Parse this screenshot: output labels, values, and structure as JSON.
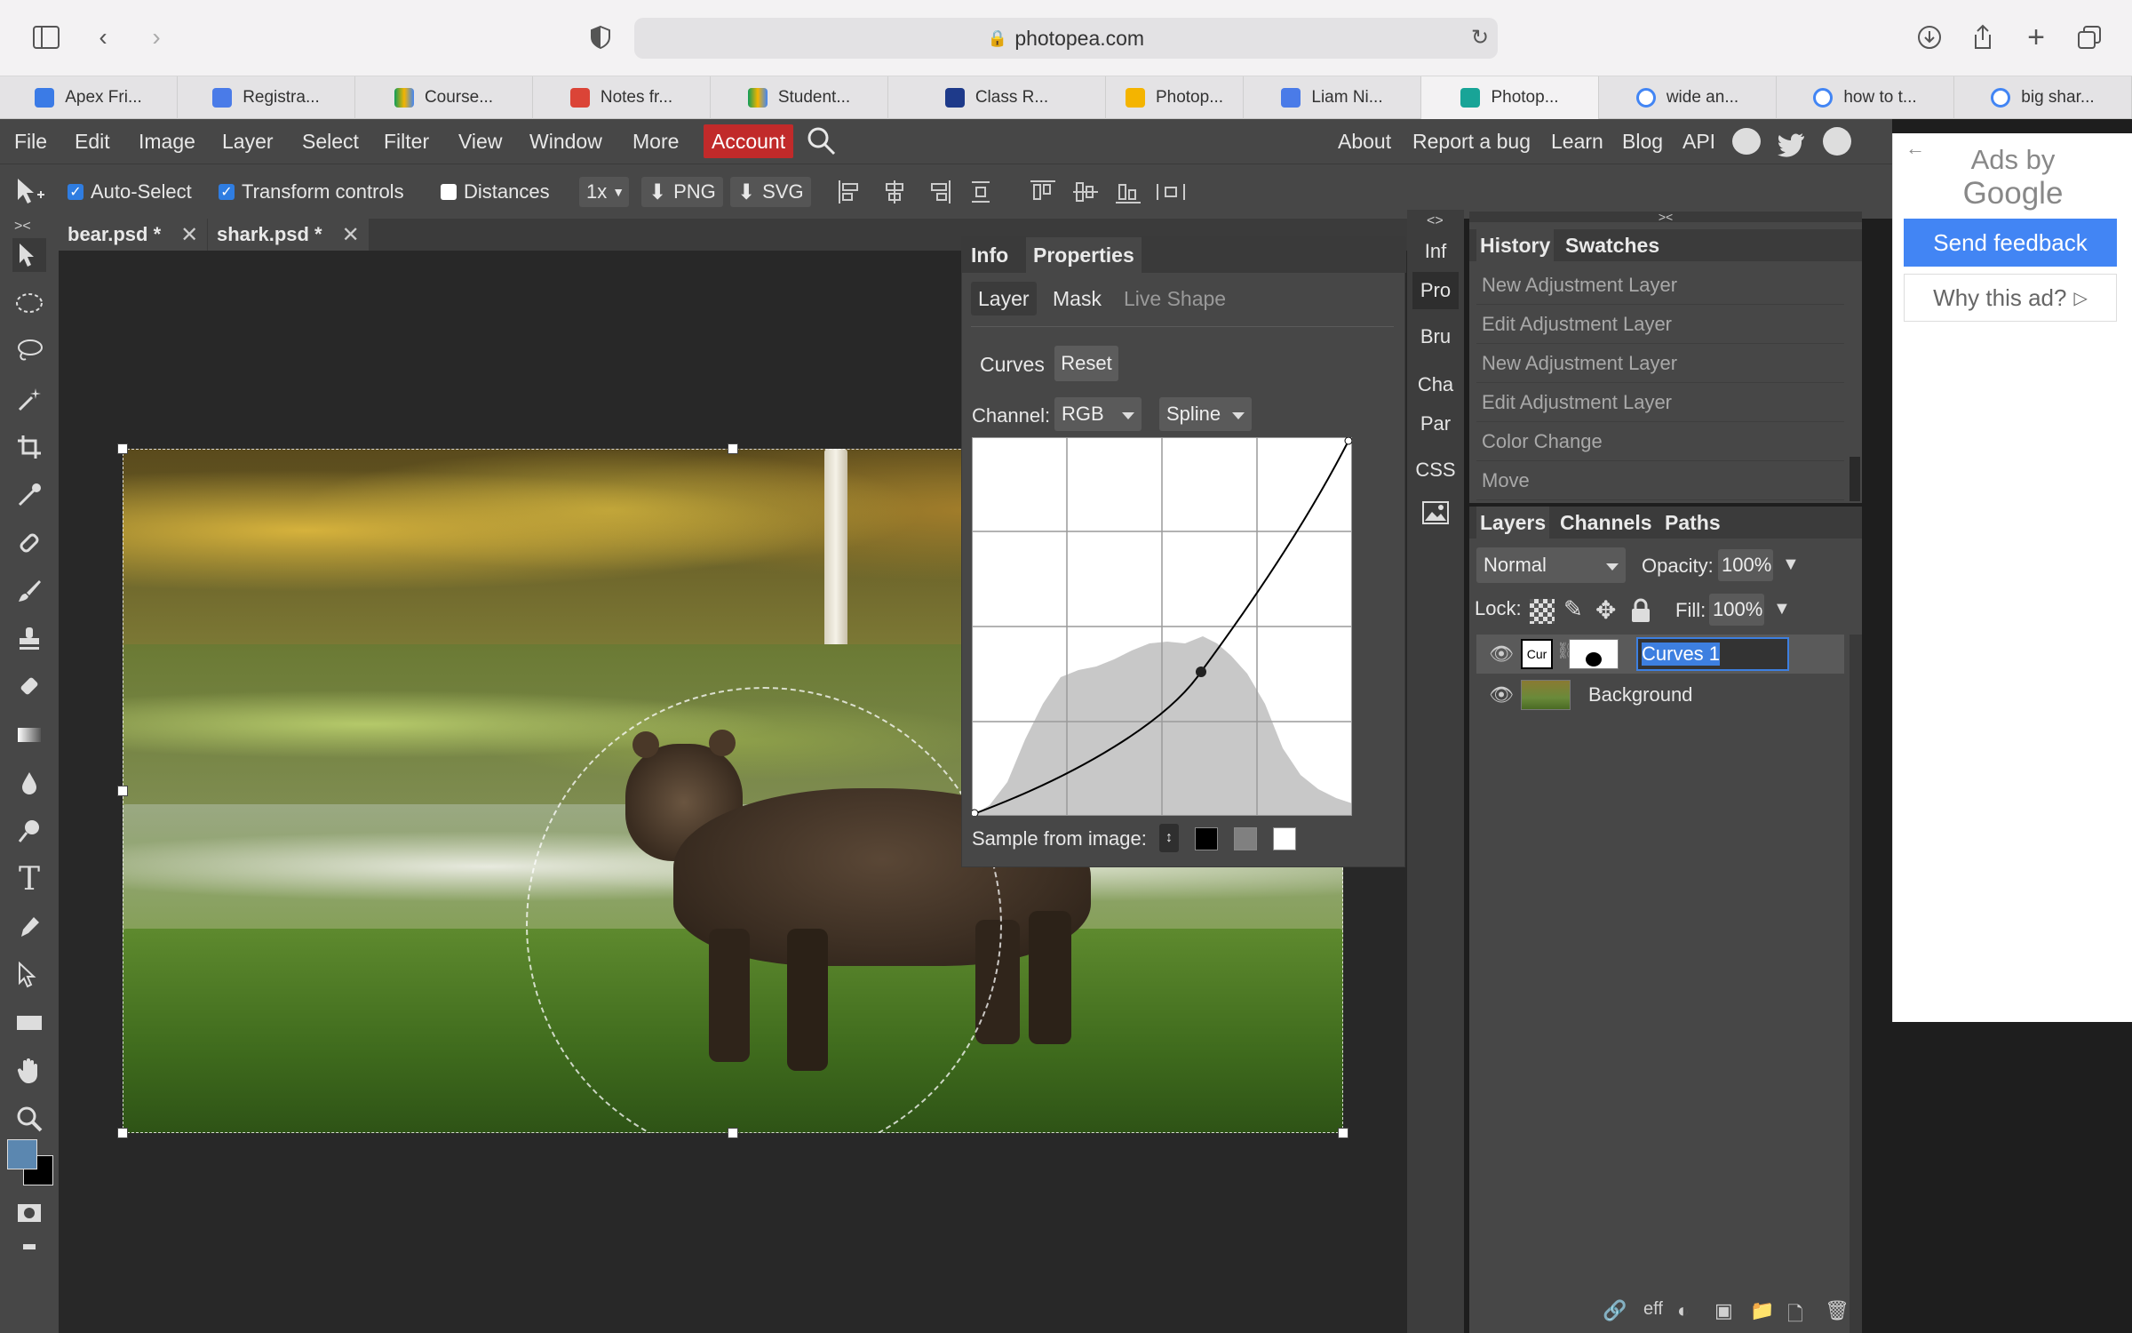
{
  "browser": {
    "url": "photopea.com",
    "tabs": [
      {
        "label": "Apex Fri...",
        "color": "#3b7be6"
      },
      {
        "label": "Registra...",
        "color": "#4a7be8"
      },
      {
        "label": "Course...",
        "color": "#f4b400"
      },
      {
        "label": "Notes fr...",
        "color": "#db4437"
      },
      {
        "label": "Student...",
        "color": "#0f9d58"
      },
      {
        "label": "Class R...",
        "color": "#1e3a8a"
      },
      {
        "label": "Photop...",
        "color": "#f4b400"
      },
      {
        "label": "Liam Ni...",
        "color": "#4a7be8"
      },
      {
        "label": "Photop...",
        "color": "#18a497"
      },
      {
        "label": "wide an...",
        "color": "#4285f4"
      },
      {
        "label": "how to t...",
        "color": "#4285f4"
      },
      {
        "label": "big shar...",
        "color": "#4285f4"
      }
    ],
    "active_tab": 8
  },
  "menu": {
    "items": [
      "File",
      "Edit",
      "Image",
      "Layer",
      "Select",
      "Filter",
      "View",
      "Window",
      "More"
    ],
    "account": "Account",
    "right_items": [
      "About",
      "Report a bug",
      "Learn",
      "Blog",
      "API"
    ]
  },
  "options": {
    "auto_select": "Auto-Select",
    "transform_controls": "Transform controls",
    "distances": "Distances",
    "zoom": "1x",
    "png": "PNG",
    "svg": "SVG"
  },
  "doc_tabs": [
    "bear.psd *",
    "shark.psd *"
  ],
  "properties": {
    "tab_info": "Info",
    "tab_properties": "Properties",
    "sub_tabs": [
      "Layer",
      "Mask",
      "Live Shape"
    ],
    "curves_label": "Curves",
    "reset_label": "Reset",
    "channel_label": "Channel:",
    "channel_value": "RGB",
    "mode_value": "Spline",
    "sample_label": "Sample from image:"
  },
  "side_buttons": [
    "Inf",
    "Pro",
    "Bru",
    "Cha",
    "Par",
    "CSS"
  ],
  "history": {
    "tab_history": "History",
    "tab_swatches": "Swatches",
    "items": [
      "New Adjustment Layer",
      "Edit Adjustment Layer",
      "New Adjustment Layer",
      "Edit Adjustment Layer",
      "Color Change",
      "Move"
    ]
  },
  "layers": {
    "tabs": [
      "Layers",
      "Channels",
      "Paths"
    ],
    "blend_mode": "Normal",
    "opacity_label": "Opacity:",
    "opacity_value": "100%",
    "lock_label": "Lock:",
    "fill_label": "Fill:",
    "fill_value": "100%",
    "curves_thumb": "Cur",
    "rows": [
      {
        "name": "Curves 1",
        "editing": true
      },
      {
        "name": "Background",
        "editing": false
      }
    ],
    "footer_eff": "eff"
  },
  "ad": {
    "ads_by": "Ads by",
    "google": "Google",
    "send_feedback": "Send feedback",
    "why_ad": "Why this ad?"
  },
  "colors": {
    "accent": "#2f7de1",
    "account_bg": "#c12a2a",
    "foreground_swatch": "#5b87b0"
  }
}
